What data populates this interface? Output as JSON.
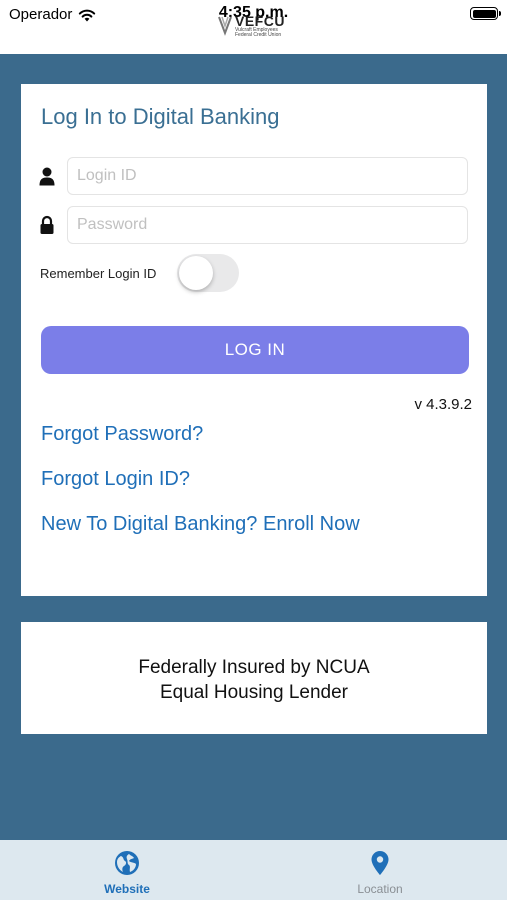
{
  "status_bar": {
    "carrier": "Operador",
    "time": "4:35 p.m.",
    "wifi_icon": "wifi-icon",
    "battery_icon": "battery-icon"
  },
  "logo": {
    "name": "VEFCU",
    "subtitle_line1": "Vulcraft Employees",
    "subtitle_line2": "Federal Credit Union"
  },
  "login_card": {
    "title": "Log In to Digital Banking",
    "login_id": {
      "value": "",
      "placeholder": "Login ID",
      "icon": "user-icon"
    },
    "password": {
      "value": "",
      "placeholder": "Password",
      "icon": "lock-icon"
    },
    "remember_label": "Remember Login ID",
    "remember_on": false,
    "login_button": "LOG IN",
    "version": "v 4.3.9.2",
    "links": {
      "forgot_password": "Forgot Password?",
      "forgot_login": "Forgot Login ID?",
      "enroll": "New To Digital Banking? Enroll Now"
    }
  },
  "insurance": {
    "line1": "Federally Insured by NCUA",
    "line2": "Equal Housing Lender"
  },
  "tab_bar": {
    "website": {
      "label": "Website",
      "icon": "globe-icon",
      "selected": true
    },
    "location": {
      "label": "Location",
      "icon": "location-pin-icon",
      "selected": false
    }
  },
  "colors": {
    "background": "#3b6a8c",
    "title": "#3a6f93",
    "link": "#1f6fb8",
    "button": "#7b7ee8",
    "tab_bar": "#dde8ef"
  }
}
